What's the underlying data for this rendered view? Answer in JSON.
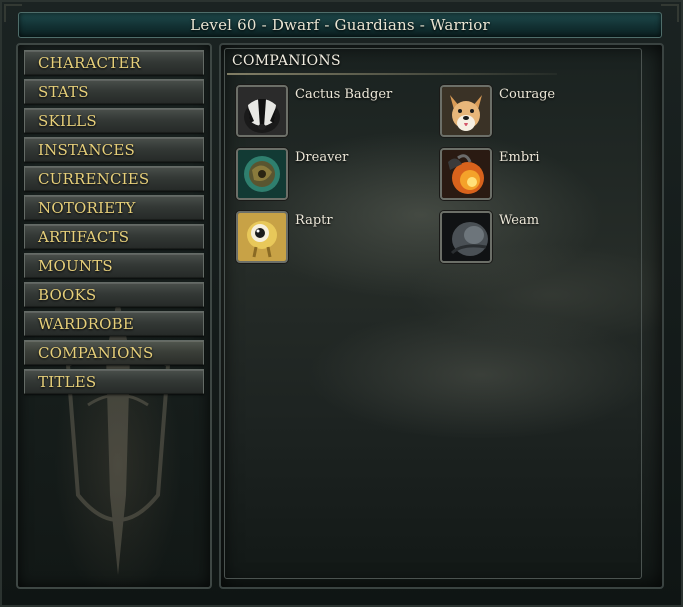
{
  "window": {
    "title": "Level 60 - Dwarf - Guardians - Warrior"
  },
  "sidebar": {
    "items": [
      {
        "label": "CHARACTER"
      },
      {
        "label": "STATS"
      },
      {
        "label": "SKILLS"
      },
      {
        "label": "INSTANCES"
      },
      {
        "label": "CURRENCIES"
      },
      {
        "label": "NOTORIETY"
      },
      {
        "label": "ARTIFACTS"
      },
      {
        "label": "MOUNTS"
      },
      {
        "label": "BOOKS"
      },
      {
        "label": "WARDROBE"
      },
      {
        "label": "COMPANIONS"
      },
      {
        "label": "TITLES"
      }
    ],
    "selected": "COMPANIONS"
  },
  "main": {
    "section_title": "COMPANIONS",
    "companions": [
      {
        "name": "Cactus Badger",
        "icon": "badger-portrait-icon"
      },
      {
        "name": "Courage",
        "icon": "dog-portrait-icon"
      },
      {
        "name": "Dreaver",
        "icon": "dreaver-portrait-icon"
      },
      {
        "name": "Embri",
        "icon": "embri-portrait-icon"
      },
      {
        "name": "Raptr",
        "icon": "raptr-portrait-icon"
      },
      {
        "name": "Weam",
        "icon": "weam-portrait-icon"
      }
    ]
  },
  "colors": {
    "nav_text": "#e6cf7a",
    "title_bar": "#1f4a4c",
    "body_text": "#ece7d8"
  }
}
